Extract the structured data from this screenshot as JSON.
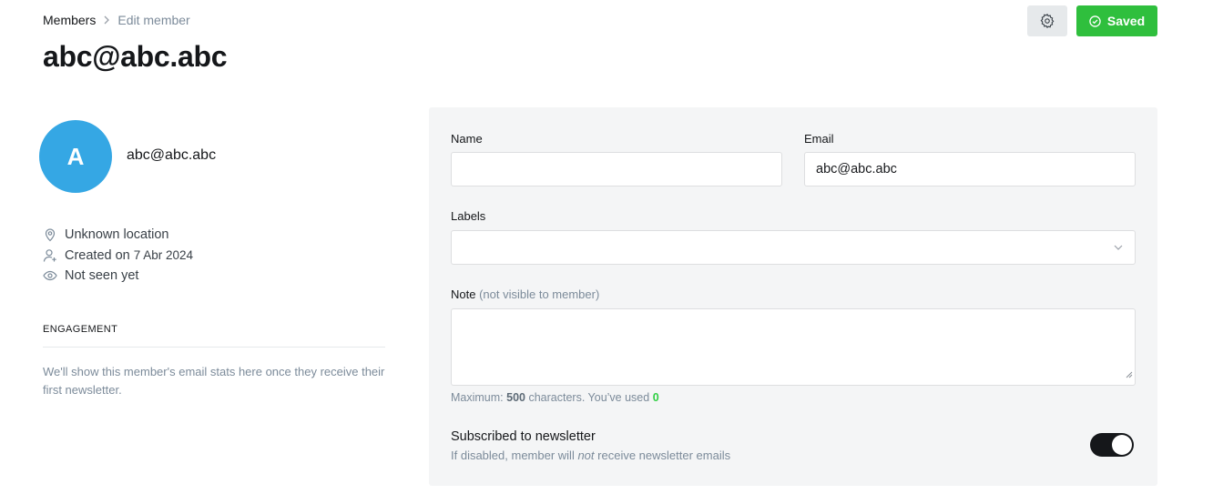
{
  "breadcrumb": {
    "parent": "Members",
    "current": "Edit member"
  },
  "page": {
    "title": "abc@abc.abc"
  },
  "header": {
    "saved_label": "Saved"
  },
  "member": {
    "avatar_initial": "A",
    "email": "abc@abc.abc",
    "location": "Unknown location",
    "created_prefix": "Created on",
    "created_date": "7 Abr 2024",
    "last_seen": "Not seen yet"
  },
  "engagement": {
    "title": "ENGAGEMENT",
    "text": "We'll show this member's email stats here once they receive their first newsletter."
  },
  "form": {
    "name_label": "Name",
    "name_value": "",
    "email_label": "Email",
    "email_value": "abc@abc.abc",
    "labels_label": "Labels",
    "note_label": "Note",
    "note_hint": "(not visible to member)",
    "counter_prefix": "Maximum:",
    "counter_max": "500",
    "counter_mid": "characters. You’ve used",
    "counter_used": "0",
    "newsletter_title": "Subscribed to newsletter",
    "newsletter_desc_pre": "If disabled, member will",
    "newsletter_desc_em": "not",
    "newsletter_desc_post": "receive newsletter emails",
    "newsletter_enabled": true
  },
  "colors": {
    "accent_green": "#30cf43",
    "avatar_blue": "#35a7e4",
    "toggle_on": "#15171a"
  },
  "icons": [
    "chevron-right-icon",
    "gear-icon",
    "check-circle-icon",
    "location-pin-icon",
    "user-add-icon",
    "eye-icon",
    "chevron-down-icon"
  ]
}
